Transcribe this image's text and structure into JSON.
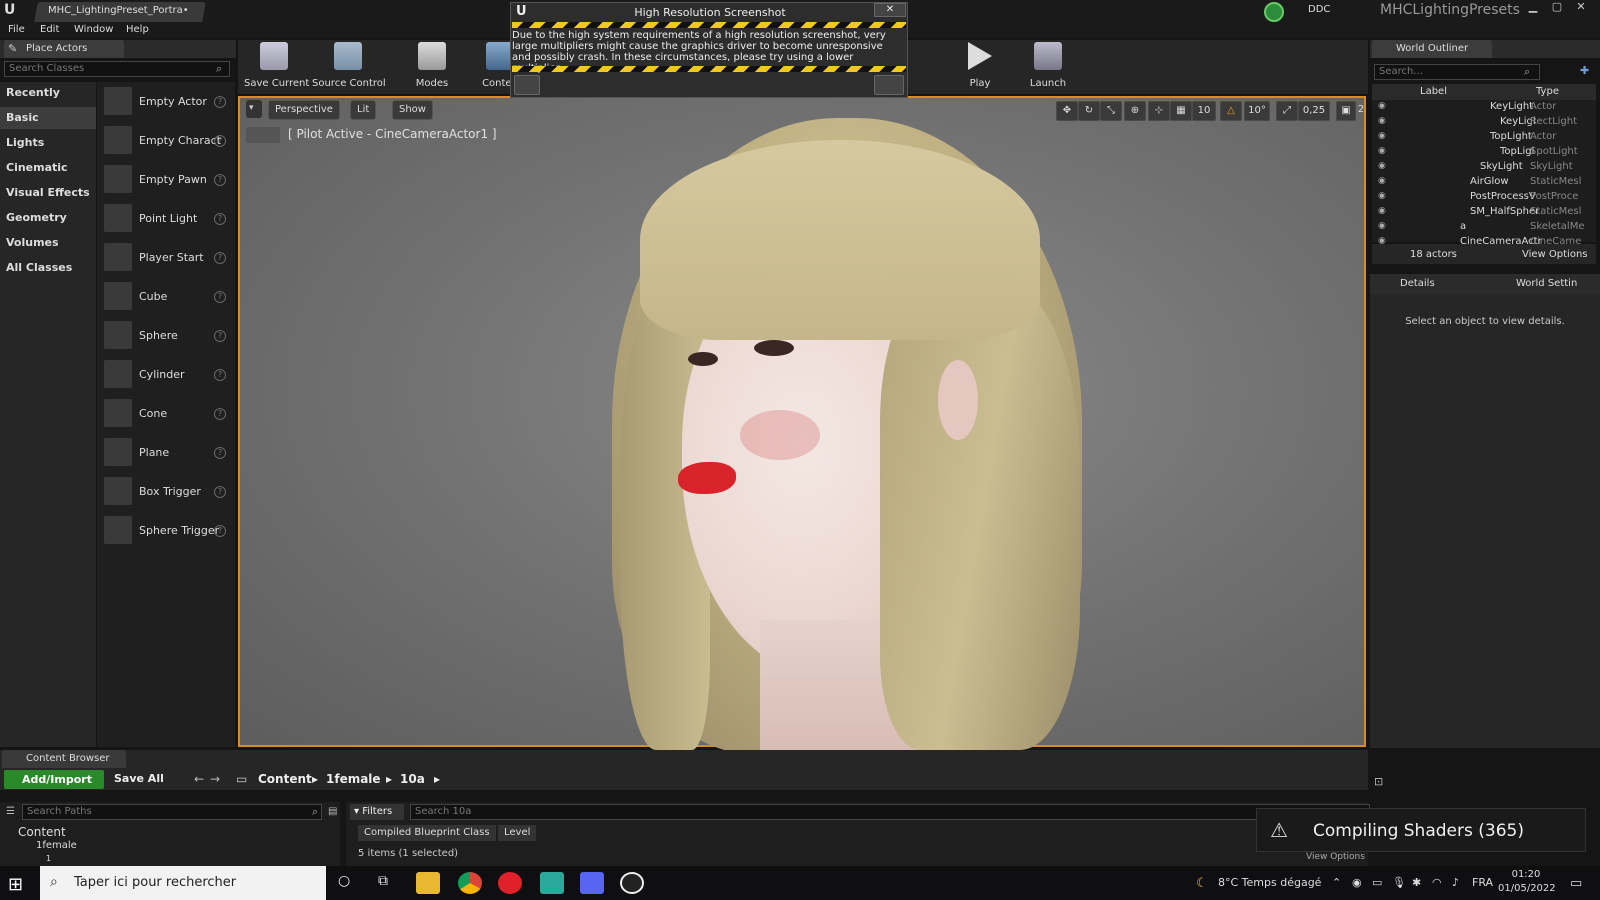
{
  "window": {
    "doc_tab": "MHC_LightingPreset_Portra•",
    "ddc": "DDC",
    "project_name": "MHCLightingPresets"
  },
  "menu": [
    "File",
    "Edit",
    "Window",
    "Help"
  ],
  "place_actors": {
    "tab": "Place Actors",
    "search_placeholder": "Search Classes",
    "categories": [
      "Recently Placed",
      "Basic",
      "Lights",
      "Cinematic",
      "Visual Effects",
      "Geometry",
      "Volumes",
      "All Classes"
    ],
    "selected_category": "Basic",
    "items": [
      "Empty Actor",
      "Empty Charact",
      "Empty Pawn",
      "Point Light",
      "Player Start",
      "Cube",
      "Sphere",
      "Cylinder",
      "Cone",
      "Plane",
      "Box Trigger",
      "Sphere Trigger"
    ]
  },
  "toolbar": {
    "save_current": "Save Current",
    "source_control": "Source Control",
    "modes": "Modes",
    "content": "Conten",
    "play": "Play",
    "launch": "Launch"
  },
  "viewport": {
    "perspective": "Perspective",
    "lit": "Lit",
    "show": "Show",
    "pilot": "[ Pilot Active - CineCameraActor1 ]",
    "grid_snap": "10",
    "rot_snap": "10°",
    "scale_snap": "0,25",
    "cam_speed": "2"
  },
  "dialog": {
    "title": "High Resolution Screenshot",
    "close": "✕",
    "message": "Due to the high system requirements of a high resolution screenshot, very large multipliers might cause the graphics driver to become unresponsive and possibly crash. In these circumstances, please try using a lower multiplier"
  },
  "outliner": {
    "tab": "World Outliner",
    "search_placeholder": "Search...",
    "col_label": "Label",
    "col_type": "Type",
    "rows": [
      {
        "label": "KeyLight",
        "type": "Actor"
      },
      {
        "label": "KeyLigl",
        "type": "RectLight"
      },
      {
        "label": "TopLight",
        "type": "Actor"
      },
      {
        "label": "TopLigl",
        "type": "SpotLight"
      },
      {
        "label": "SkyLight",
        "type": "SkyLight"
      },
      {
        "label": "AirGlow",
        "type": "StaticMesl"
      },
      {
        "label": "PostProcessV",
        "type": "PostProce"
      },
      {
        "label": "SM_HalfSpher",
        "type": "StaticMesl"
      },
      {
        "label": "a",
        "type": "SkeletalMe"
      },
      {
        "label": "CineCameraActr",
        "type": "CineCame"
      }
    ],
    "count": "18 actors",
    "view_options": "View Options"
  },
  "details": {
    "tab1": "Details",
    "tab2": "World Settin",
    "empty_msg": "Select an object to view details."
  },
  "content_browser": {
    "tab": "Content Browser",
    "add_import": "Add/Import",
    "save_all": "Save All",
    "crumbs": [
      "Content",
      "1female",
      "10a"
    ],
    "paths_placeholder": "Search Paths",
    "filters": "Filters",
    "search_placeholder": "Search 10a",
    "tree": [
      "Content",
      "1female",
      "1"
    ],
    "chips": [
      "Compiled Blueprint Class",
      "Level"
    ],
    "status": "5 items (1 selected)",
    "view_options": "View Options"
  },
  "notification": "Compiling Shaders (365)",
  "taskbar": {
    "search": "Taper ici pour rechercher",
    "weather": "8°C  Temps dégagé",
    "lang": "FRA",
    "time": "01:20",
    "date": "01/05/2022"
  },
  "colors": {
    "accent_orange": "#d98c1f",
    "add_green": "#2a8a2a",
    "hazard_yellow": "#f0c81e",
    "lips": "#d8232b"
  }
}
